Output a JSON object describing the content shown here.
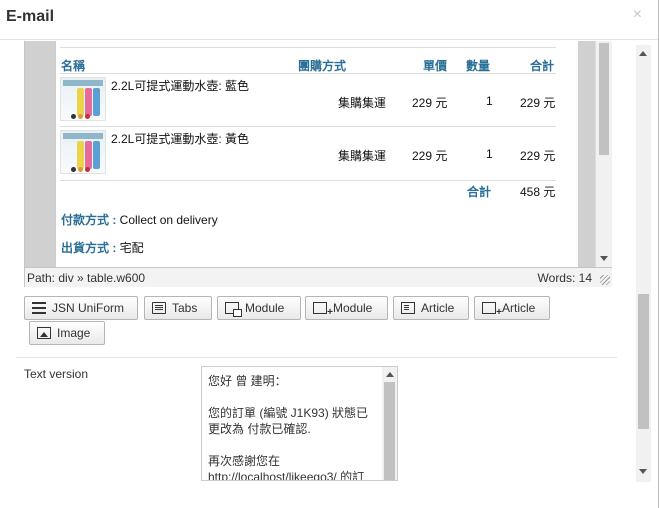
{
  "modal": {
    "title": "E-mail",
    "close": "×"
  },
  "order": {
    "headers": {
      "name": "名稱",
      "shipping": "團購方式",
      "price": "單價",
      "qty": "數量",
      "total": "合計"
    },
    "items": [
      {
        "name": "2.2L可提式運動水壺: 藍色",
        "shipping": "集購集運",
        "price": "229 元",
        "qty": "1",
        "total": "229 元"
      },
      {
        "name": "2.2L可提式運動水壺: 黃色",
        "shipping": "集購集運",
        "price": "229 元",
        "qty": "1",
        "total": "229 元"
      }
    ],
    "sum_label": "合計",
    "sum_value": "458 元",
    "payment_label": "付款方式 :",
    "payment_value": " Collect on delivery",
    "delivery_label": "出貨方式 :",
    "delivery_value": " 宅配"
  },
  "status": {
    "path": "Path: div » table.w600",
    "words": "Words: 14"
  },
  "toolbar": {
    "buttons": [
      {
        "label": "JSN UniForm",
        "icon": "list-icon"
      },
      {
        "label": "Tabs",
        "icon": "tabs-icon"
      },
      {
        "label": "Module",
        "icon": "module-icon"
      },
      {
        "label": "Module",
        "icon": "add-module-icon"
      },
      {
        "label": "Article",
        "icon": "article-icon"
      },
      {
        "label": "Article",
        "icon": "add-article-icon"
      },
      {
        "label": "Image",
        "icon": "image-icon"
      }
    ]
  },
  "text_version": {
    "label": "Text version",
    "content": "您好 曾 建明：\n\n您的訂單 (編號 J1K93) 狀態已更改為 付款已確認.\n\n再次感謝您在\nhttp://localhost/likeego3/ 的訂"
  },
  "colors": {
    "accent": "#2a6f97",
    "editor_frame": "#d0d0d0"
  }
}
